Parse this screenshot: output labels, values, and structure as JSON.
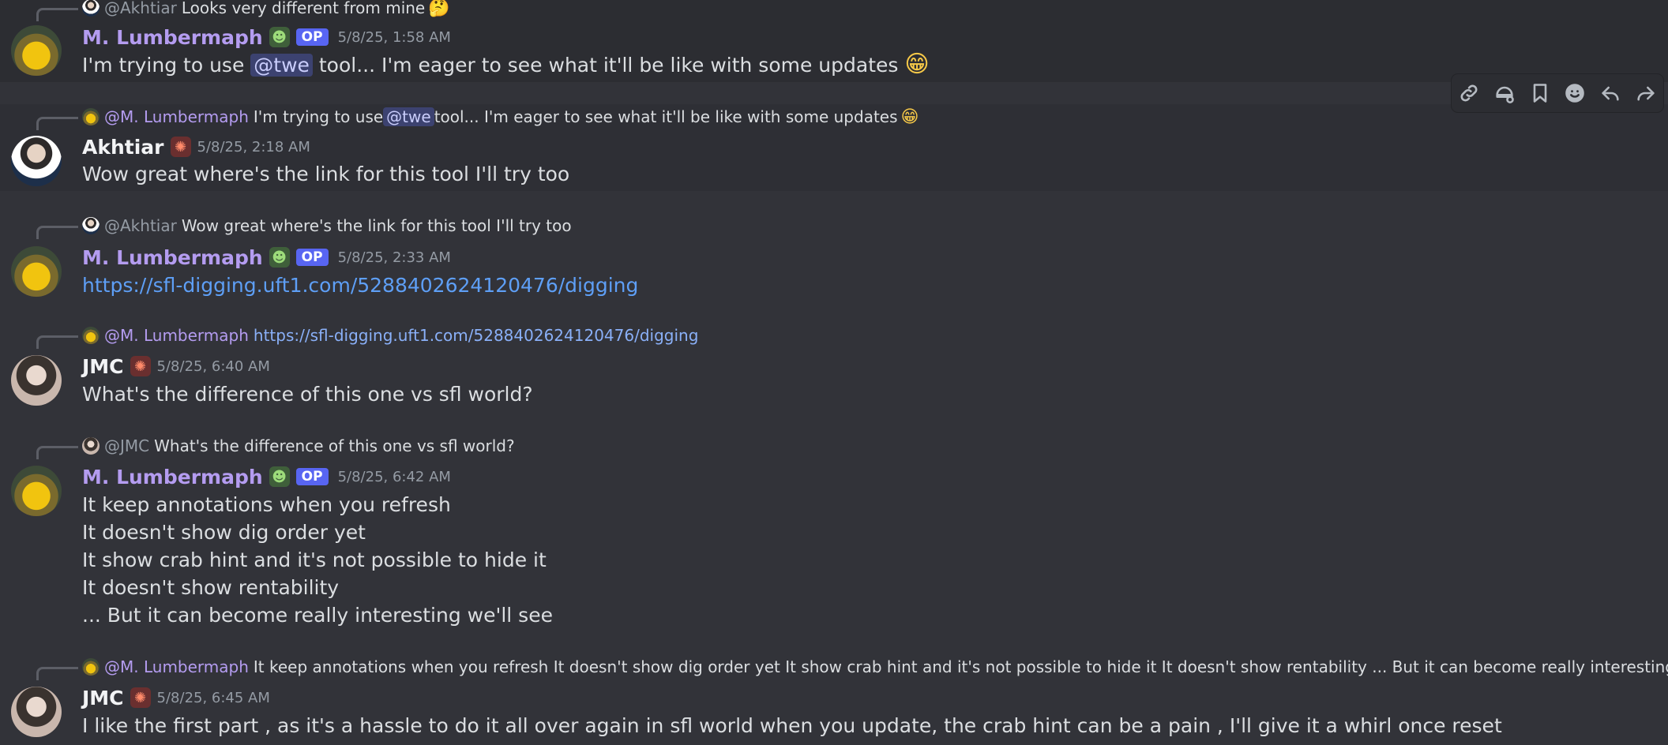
{
  "messages": [
    {
      "reply": {
        "author": "@Akhtiar",
        "text": "Looks very different from mine",
        "emoji": "🤔"
      },
      "author": "M. Lumbermaph",
      "role_icon": "goblin-icon",
      "badge": "OP",
      "time": "5/8/25, 1:58 AM",
      "content_pre": "I'm trying to use ",
      "mention": "@twe",
      "content_post": " tool... I'm eager to see what it'll be like with some updates",
      "emoji": "😁"
    },
    {
      "reply": {
        "author": "@M. Lumbermaph",
        "text_pre": "I'm trying to use ",
        "mention": "@twe",
        "text_post": " tool... I'm eager to see what it'll be like with some updates",
        "emoji": "😁"
      },
      "author": "Akhtiar",
      "role_icon": "crab-icon",
      "time": "5/8/25, 2:18 AM",
      "content": "Wow great where's the link for this tool I'll try too"
    },
    {
      "reply": {
        "author": "@Akhtiar",
        "text": "Wow great where's the link for this tool I'll try too"
      },
      "author": "M. Lumbermaph",
      "role_icon": "goblin-icon",
      "badge": "OP",
      "time": "5/8/25, 2:33 AM",
      "link": "https://sfl-digging.uft1.com/5288402624120476/digging"
    },
    {
      "reply": {
        "author": "@M. Lumbermaph",
        "link": "https://sfl-digging.uft1.com/5288402624120476/digging"
      },
      "author": "JMC",
      "role_icon": "crab-icon",
      "time": "5/8/25, 6:40 AM",
      "content": "What's the difference of this one vs sfl world?"
    },
    {
      "reply": {
        "author": "@JMC",
        "text": "What's the difference of this one vs sfl world?"
      },
      "author": "M. Lumbermaph",
      "role_icon": "goblin-icon",
      "badge": "OP",
      "time": "5/8/25, 6:42 AM",
      "lines": [
        "It keep annotations when you refresh",
        "It doesn't show dig order yet",
        "It show crab hint and it's not possible to hide it",
        "It doesn't show rentability",
        "... But it can become really interesting we'll see"
      ]
    },
    {
      "reply": {
        "author": "@M. Lumbermaph",
        "text": "It keep annotations when you refresh It doesn't show dig order yet It show crab hint and it's not possible to hide it It doesn't show rentability ... But it can become really interesting we'll see"
      },
      "author": "JMC",
      "role_icon": "crab-icon",
      "time": "5/8/25, 6:45 AM",
      "content": "I like the first part , as it's a hassle to do it all over again in sfl world when you update, the crab hint can be a pain , I'll give it a whirl once reset"
    }
  ],
  "toolbar": {
    "icons": [
      "link-icon",
      "add-reaction-icon",
      "bookmark-icon",
      "emoji-icon",
      "reply-icon",
      "forward-icon"
    ]
  },
  "colors": {
    "background": "#323339",
    "op_name": "#b49cf0",
    "link": "#5e9ff6",
    "mention_bg": "#3c4270"
  }
}
